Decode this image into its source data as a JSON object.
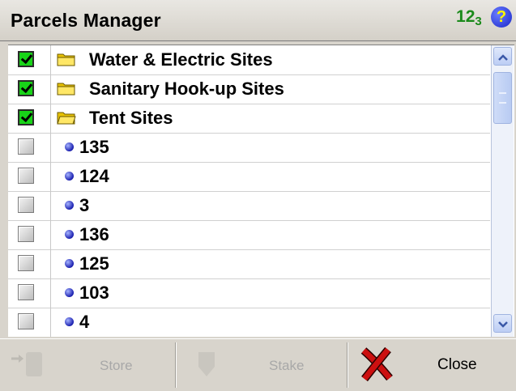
{
  "header": {
    "title": "Parcels Manager",
    "numfmt_main": "1",
    "numfmt_sup": "2",
    "numfmt_sub": "3",
    "help_glyph": "?"
  },
  "list": {
    "rows": [
      {
        "label": "Water & Electric Sites",
        "checked": true,
        "icon": "folder-icon"
      },
      {
        "label": "Sanitary Hook-up Sites",
        "checked": true,
        "icon": "folder-icon"
      },
      {
        "label": "Tent Sites",
        "checked": true,
        "icon": "open-folder-icon"
      },
      {
        "label": "135",
        "checked": false,
        "icon": "parcel-dot-icon"
      },
      {
        "label": "124",
        "checked": false,
        "icon": "parcel-dot-icon"
      },
      {
        "label": "3",
        "checked": false,
        "icon": "parcel-dot-icon"
      },
      {
        "label": "136",
        "checked": false,
        "icon": "parcel-dot-icon"
      },
      {
        "label": "125",
        "checked": false,
        "icon": "parcel-dot-icon"
      },
      {
        "label": "103",
        "checked": false,
        "icon": "parcel-dot-icon"
      },
      {
        "label": "4",
        "checked": false,
        "icon": "parcel-dot-icon"
      }
    ]
  },
  "toolbar": {
    "store_label": "Store",
    "stake_label": "Stake",
    "close_label": "Close"
  },
  "colors": {
    "checkbox_on": "#18d418",
    "close_icon": "#cc1010",
    "numfmt": "#1b8a1b"
  }
}
